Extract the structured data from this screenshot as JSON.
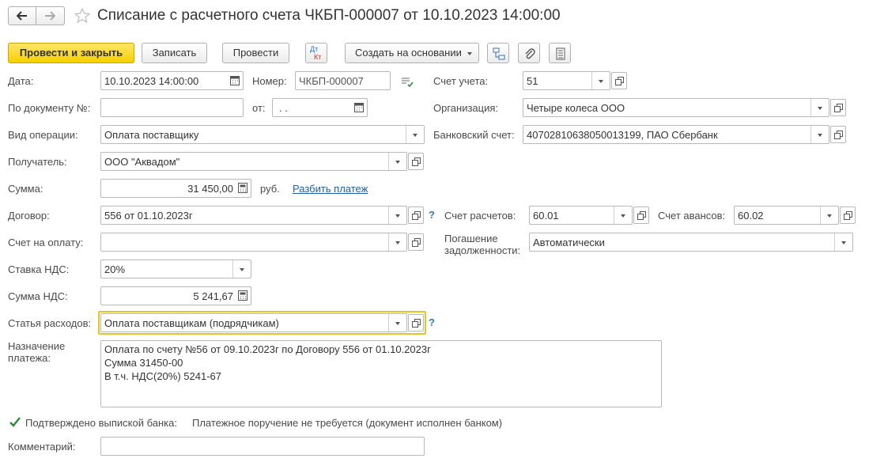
{
  "window": {
    "title": "Списание с расчетного счета ЧКБП-000007 от 10.10.2023 14:00:00"
  },
  "toolbar": {
    "post_close": "Провести и закрыть",
    "save": "Записать",
    "post": "Провести",
    "dt_kt_top": "Дт",
    "dt_kt_bottom": "Кт",
    "create_based": "Создать на основании"
  },
  "form": {
    "date": {
      "label": "Дата:",
      "value": "10.10.2023 14:00:00"
    },
    "number": {
      "label": "Номер:",
      "value": "ЧКБП-000007"
    },
    "account": {
      "label": "Счет учета:",
      "value": "51"
    },
    "doc_number": {
      "label": "По документу №:",
      "value": ""
    },
    "from": {
      "label": "от:",
      "value": " .  ."
    },
    "organization": {
      "label": "Организация:",
      "value": "Четыре колеса ООО"
    },
    "operation": {
      "label": "Вид операции:",
      "value": "Оплата поставщику"
    },
    "bank_account": {
      "label": "Банковский счет:",
      "value": "40702810638050013199, ПАО Сбербанк"
    },
    "recipient": {
      "label": "Получатель:",
      "value": "ООО \"Аквадом\""
    },
    "amount": {
      "label": "Сумма:",
      "value": "31 450,00",
      "currency": "руб.",
      "split_link": "Разбить платеж"
    },
    "contract": {
      "label": "Договор:",
      "value": "556 от 01.10.2023г",
      "help": "?"
    },
    "settlement_account": {
      "label": "Счет расчетов:",
      "value": "60.01"
    },
    "advance_account": {
      "label": "Счет авансов:",
      "value": "60.02"
    },
    "invoice": {
      "label": "Счет на оплату:",
      "value": ""
    },
    "repayment": {
      "label_line1": "Погашение",
      "label_line2": "задолженности:",
      "value": "Автоматически"
    },
    "vat_rate": {
      "label": "Ставка НДС:",
      "value": "20%"
    },
    "vat_amount": {
      "label": "Сумма НДС:",
      "value": "5 241,67"
    },
    "expense_item": {
      "label": "Статья расходов:",
      "value": "Оплата поставщикам (подрядчикам)",
      "help": "?"
    },
    "purpose": {
      "label_line1": "Назначение",
      "label_line2": "платежа:",
      "line1": "Оплата по счету №56 от 09.10.2023г по  Договору 556 от 01.10.2023г",
      "line2": "Сумма 31450-00",
      "line3": "В т.ч. НДС(20%) 5241-67"
    },
    "bank_confirmed": {
      "label": "Подтверждено выпиской банка:",
      "checked": true,
      "note": "Платежное поручение не требуется (документ исполнен банком)"
    },
    "comment": {
      "label": "Комментарий:",
      "value": ""
    }
  },
  "colors": {
    "primary_button": "#f7d000",
    "focus_border": "#e8c325",
    "link": "#1f5ea8",
    "help": "#2f78c4",
    "checkbox": "#2e8b3a"
  }
}
